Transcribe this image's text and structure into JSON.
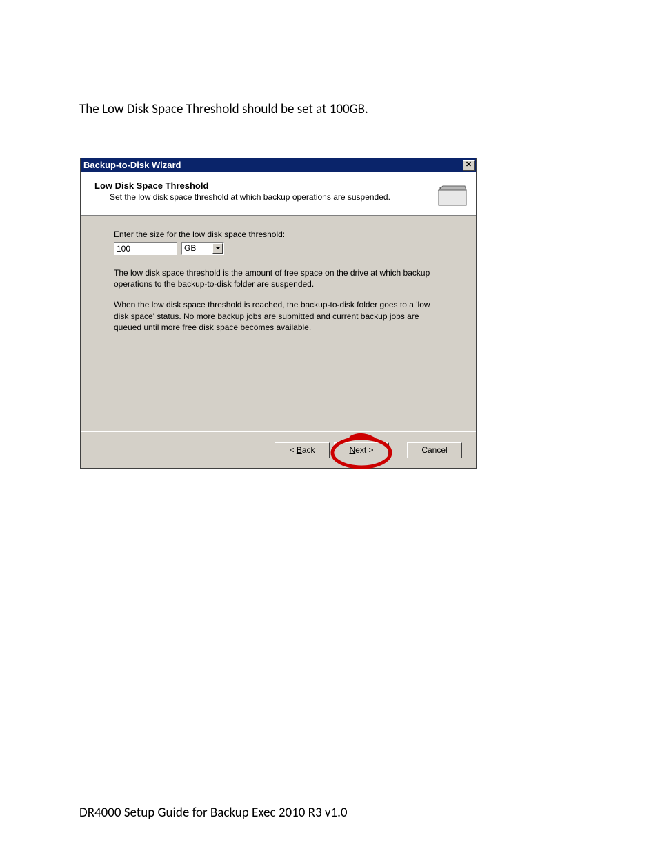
{
  "page": {
    "intro": "The Low Disk Space Threshold should be set at 100GB.",
    "footer": "DR4000 Setup Guide for Backup Exec 2010 R3 v1.0"
  },
  "dialog": {
    "title": "Backup-to-Disk Wizard",
    "header_title": "Low Disk Space Threshold",
    "header_sub": "Set the low disk space threshold at which backup operations are suspended.",
    "prompt_prefix": "E",
    "prompt_rest": "nter the size for the low disk space threshold:",
    "size_value": "100",
    "unit_value": "GB",
    "desc1": "The low disk space threshold is the amount of free space on the drive at which backup operations to the backup-to-disk folder are suspended.",
    "desc2": "When the low disk space threshold is reached, the backup-to-disk folder goes to a 'low disk space' status.  No more backup jobs are submitted and current backup jobs are queued until more free disk space becomes available.",
    "buttons": {
      "back_prefix": "< ",
      "back_u": "B",
      "back_rest": "ack",
      "next_u": "N",
      "next_rest": "ext >",
      "cancel": "Cancel"
    }
  }
}
